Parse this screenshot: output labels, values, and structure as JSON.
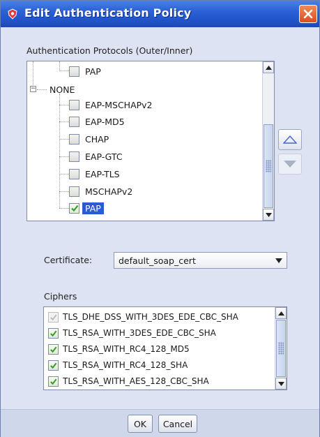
{
  "window": {
    "title": "Edit Authentication Policy"
  },
  "protocols": {
    "label": "Authentication Protocols (Outer/Inner)",
    "items": [
      {
        "label": "PAP",
        "checked": false
      },
      {
        "label": "NONE"
      },
      {
        "label": "EAP-MSCHAPv2",
        "checked": false
      },
      {
        "label": "EAP-MD5",
        "checked": false
      },
      {
        "label": "CHAP",
        "checked": false
      },
      {
        "label": "EAP-GTC",
        "checked": false
      },
      {
        "label": "EAP-TLS",
        "checked": false
      },
      {
        "label": "MSCHAPv2",
        "checked": false
      },
      {
        "label": "PAP",
        "checked": true,
        "selected": true
      }
    ]
  },
  "certificate": {
    "label": "Certificate:",
    "value": "default_soap_cert"
  },
  "ciphers": {
    "label": "Ciphers",
    "items": [
      {
        "label": "TLS_DHE_DSS_WITH_3DES_EDE_CBC_SHA",
        "checked": true,
        "disabled": true
      },
      {
        "label": "TLS_RSA_WITH_3DES_EDE_CBC_SHA",
        "checked": true
      },
      {
        "label": "TLS_RSA_WITH_RC4_128_MD5",
        "checked": true
      },
      {
        "label": "TLS_RSA_WITH_RC4_128_SHA",
        "checked": true
      },
      {
        "label": "TLS_RSA_WITH_AES_128_CBC_SHA",
        "checked": true
      }
    ]
  },
  "buttons": {
    "ok": "OK",
    "cancel": "Cancel"
  },
  "colors": {
    "titlebar": "#2b60d6",
    "selection": "#2a5ad7",
    "check": "#3a9a2a",
    "close": "#d94e1e"
  }
}
